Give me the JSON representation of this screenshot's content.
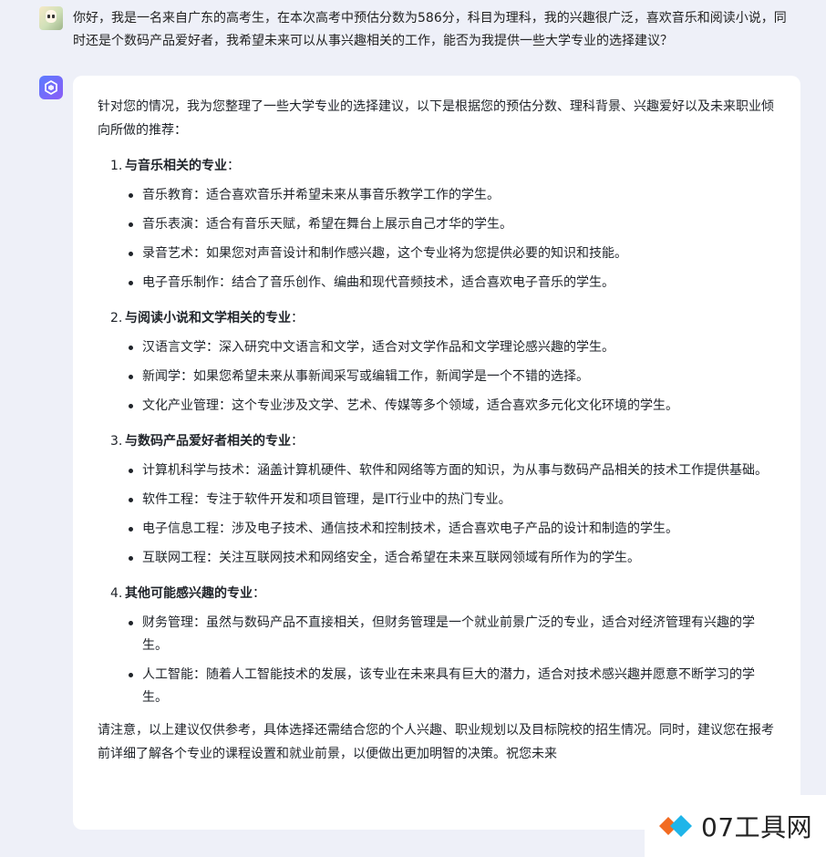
{
  "user_message": "你好，我是一名来自广东的高考生，在本次高考中预估分数为586分，科目为理科，我的兴趣很广泛，喜欢音乐和阅读小说，同时还是个数码产品爱好者，我希望未来可以从事兴趣相关的工作，能否为我提供一些大学专业的选择建议？",
  "assistant": {
    "intro": "针对您的情况，我为您整理了一些大学专业的选择建议，以下是根据您的预估分数、理科背景、兴趣爱好以及未来职业倾向所做的推荐：",
    "sections": [
      {
        "number": "1.",
        "title": "与音乐相关的专业",
        "suffix": "：",
        "items": [
          "音乐教育：适合喜欢音乐并希望未来从事音乐教学工作的学生。",
          "音乐表演：适合有音乐天赋，希望在舞台上展示自己才华的学生。",
          "录音艺术：如果您对声音设计和制作感兴趣，这个专业将为您提供必要的知识和技能。",
          "电子音乐制作：结合了音乐创作、编曲和现代音频技术，适合喜欢电子音乐的学生。"
        ]
      },
      {
        "number": "2.",
        "title": "与阅读小说和文学相关的专业",
        "suffix": "：",
        "items": [
          "汉语言文学：深入研究中文语言和文学，适合对文学作品和文学理论感兴趣的学生。",
          "新闻学：如果您希望未来从事新闻采写或编辑工作，新闻学是一个不错的选择。",
          "文化产业管理：这个专业涉及文学、艺术、传媒等多个领域，适合喜欢多元化文化环境的学生。"
        ]
      },
      {
        "number": "3.",
        "title": "与数码产品爱好者相关的专业",
        "suffix": "：",
        "items": [
          "计算机科学与技术：涵盖计算机硬件、软件和网络等方面的知识，为从事与数码产品相关的技术工作提供基础。",
          "软件工程：专注于软件开发和项目管理，是IT行业中的热门专业。",
          "电子信息工程：涉及电子技术、通信技术和控制技术，适合喜欢电子产品的设计和制造的学生。",
          "互联网工程：关注互联网技术和网络安全，适合希望在未来互联网领域有所作为的学生。"
        ]
      },
      {
        "number": "4.",
        "title": "其他可能感兴趣的专业",
        "suffix": "：",
        "items": [
          "财务管理：虽然与数码产品不直接相关，但财务管理是一个就业前景广泛的专业，适合对经济管理有兴趣的学生。",
          "人工智能：随着人工智能技术的发展，该专业在未来具有巨大的潜力，适合对技术感兴趣并愿意不断学习的学生。"
        ]
      }
    ],
    "closing": "请注意，以上建议仅供参考，具体选择还需结合您的个人兴趣、职业规划以及目标院校的招生情况。同时，建议您在报考前详细了解各个专业的课程设置和就业前景，以便做出更加明智的决策。祝您未来"
  },
  "watermark": {
    "text": "07工具网",
    "colors": [
      "#f26b21",
      "#1fb5e9"
    ]
  },
  "icons": {
    "user_avatar": "user-avatar-icon",
    "assistant_avatar": "assistant-logo-icon"
  }
}
